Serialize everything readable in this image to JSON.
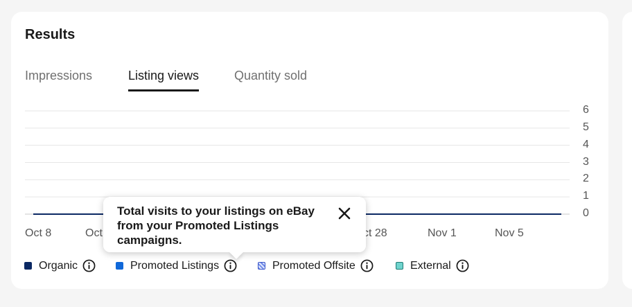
{
  "card": {
    "title": "Results"
  },
  "tabs": [
    {
      "label": "Impressions",
      "active": false
    },
    {
      "label": "Listing views",
      "active": true
    },
    {
      "label": "Quantity sold",
      "active": false
    }
  ],
  "chart_data": {
    "type": "line",
    "y_ticks": [
      "6",
      "5",
      "4",
      "3",
      "2",
      "1",
      "0"
    ],
    "ylim": [
      0,
      6
    ],
    "x_ticks": [
      "Oct 8",
      "Oct",
      "ct 28",
      "Nov 1",
      "Nov 5"
    ],
    "series": [
      {
        "name": "Organic",
        "values": [
          0,
          0,
          0,
          0,
          0,
          0,
          0,
          0,
          0,
          0
        ]
      }
    ],
    "grid": true,
    "y_axis_position": "right"
  },
  "legend": [
    {
      "label": "Organic",
      "color": "#0b2863",
      "info": true,
      "style": "solid"
    },
    {
      "label": "Promoted Listings",
      "color": "#1068d9",
      "info": true,
      "style": "solid"
    },
    {
      "label": "Promoted Offsite",
      "color": "#6f8ae8",
      "info": true,
      "style": "hatched"
    },
    {
      "label": "External",
      "color": "#6fd3cd",
      "info": true,
      "style": "solid-outlined"
    }
  ],
  "tooltip": {
    "text": "Total visits to your listings on eBay from your Promoted Listings campaigns.",
    "close_icon": "close-icon"
  },
  "icons": {
    "info": "info-circle-icon",
    "close": "close-icon"
  }
}
